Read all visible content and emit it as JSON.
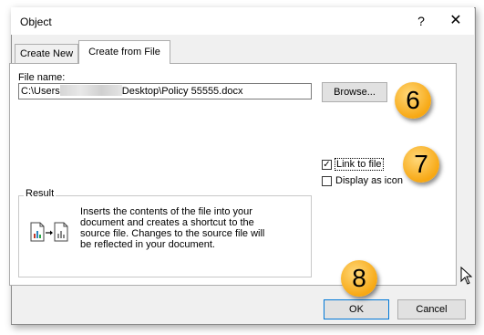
{
  "window": {
    "title": "Object",
    "help": "?",
    "close": "✕"
  },
  "tabs": [
    {
      "label": "Create New",
      "active": false
    },
    {
      "label": "Create from File",
      "active": true
    }
  ],
  "file": {
    "label": "File name:",
    "value_prefix": "C:\\Users",
    "value_suffix": "Desktop\\Policy 55555.docx"
  },
  "browse_label": "Browse...",
  "link_to_file": {
    "label": "Link to file",
    "checked": true
  },
  "display_as_icon": {
    "label": "Display as icon",
    "checked": false
  },
  "result": {
    "title": "Result",
    "lines": [
      "Inserts the contents of the file into your",
      "document and creates a shortcut to the",
      "source file.  Changes to the source file will",
      "be reflected in your document."
    ]
  },
  "buttons": {
    "ok": "OK",
    "cancel": "Cancel"
  },
  "callouts": {
    "browse": "6",
    "link": "7",
    "ok": "8"
  },
  "colors": {
    "callout": "#f7a814",
    "accent": "#0078d7"
  }
}
